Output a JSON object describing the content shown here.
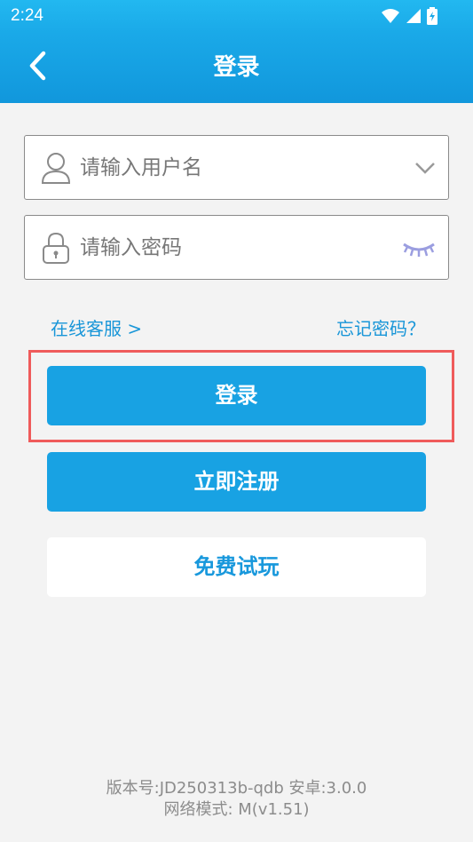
{
  "status_bar": {
    "time": "2:24",
    "icons": [
      "wifi-icon",
      "signal-icon",
      "battery-charging-icon"
    ]
  },
  "header": {
    "title": "登录",
    "back_icon": "chevron-left-icon"
  },
  "username_field": {
    "placeholder": "请输入用户名",
    "lead_icon": "user-icon",
    "trail_icon": "chevron-down-icon"
  },
  "password_field": {
    "placeholder": "请输入密码",
    "lead_icon": "lock-icon",
    "trail_icon": "eye-closed-icon"
  },
  "links": {
    "customer_service": "在线客服 >",
    "forgot_password": "忘记密码？"
  },
  "buttons": {
    "login": "登录",
    "register": "立即注册",
    "free_trial": "免费试玩"
  },
  "footer": {
    "version": "版本号:JD250313b-qdb  安卓:3.0.0",
    "network_mode": "网络模式: M(v1.51)"
  },
  "colors": {
    "primary": "#18a2e3",
    "header": "#1aa9e8",
    "highlight": "#ef5b5b",
    "link": "#1996d8"
  }
}
